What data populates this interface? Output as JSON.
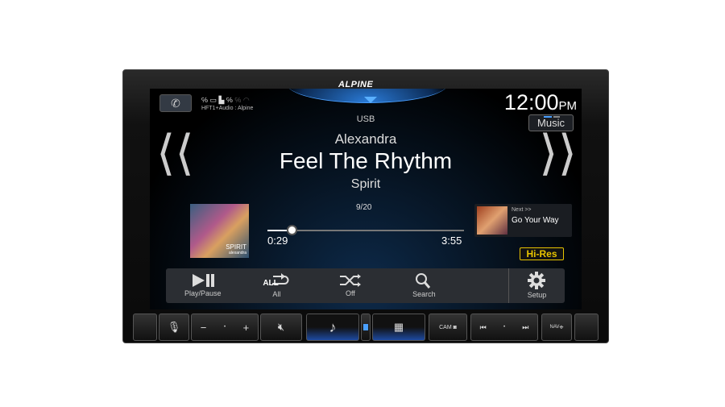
{
  "brand": "ALPINE",
  "status": {
    "connection": "HFT1+Audio : Alpine",
    "clock": "12:00",
    "ampm": "PM",
    "source_button": "Music"
  },
  "source": "USB",
  "track": {
    "artist": "Alexandra",
    "title": "Feel The Rhythm",
    "album": "Spirit",
    "index": "9/20",
    "elapsed": "0:29",
    "duration": "3:55",
    "progress_fraction": 0.123,
    "album_art_text": "SPIRIT",
    "album_art_subtext": "alexandra"
  },
  "next": {
    "label": "Next >>",
    "title": "Go Your Way"
  },
  "badge": "Hi-Res",
  "controls": [
    {
      "label": "Play/Pause",
      "icon": "play-pause-icon"
    },
    {
      "label": "All",
      "icon": "repeat-all-icon",
      "icon_text": "ALL"
    },
    {
      "label": "Off",
      "icon": "shuffle-icon"
    },
    {
      "label": "Search",
      "icon": "search-icon"
    },
    {
      "label": "Setup",
      "icon": "gear-icon"
    }
  ],
  "hardware": {
    "cam": "CAM",
    "nav": "NAV"
  },
  "colors": {
    "accent": "#4aa0ff",
    "badge": "#e8c400"
  }
}
